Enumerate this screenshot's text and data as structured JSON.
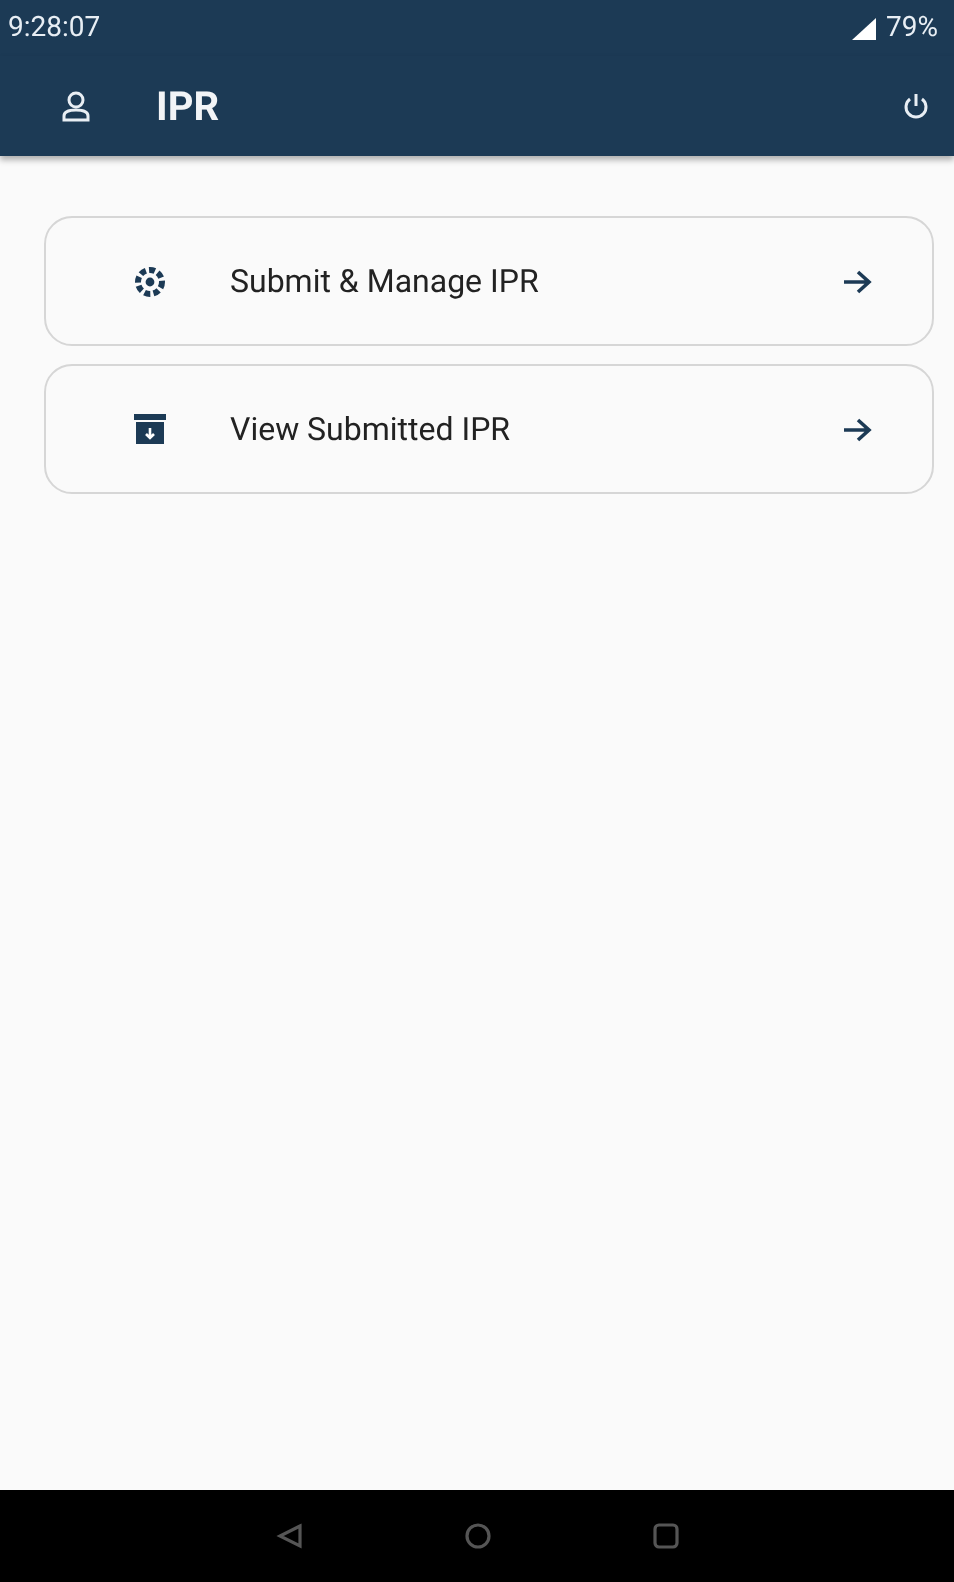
{
  "status_bar": {
    "time": "9:28:07",
    "battery": "79%"
  },
  "app_bar": {
    "title": "IPR"
  },
  "menu": [
    {
      "kind": "manage",
      "label": "Submit & Manage IPR"
    },
    {
      "kind": "archive",
      "label": "View Submitted IPR"
    }
  ]
}
